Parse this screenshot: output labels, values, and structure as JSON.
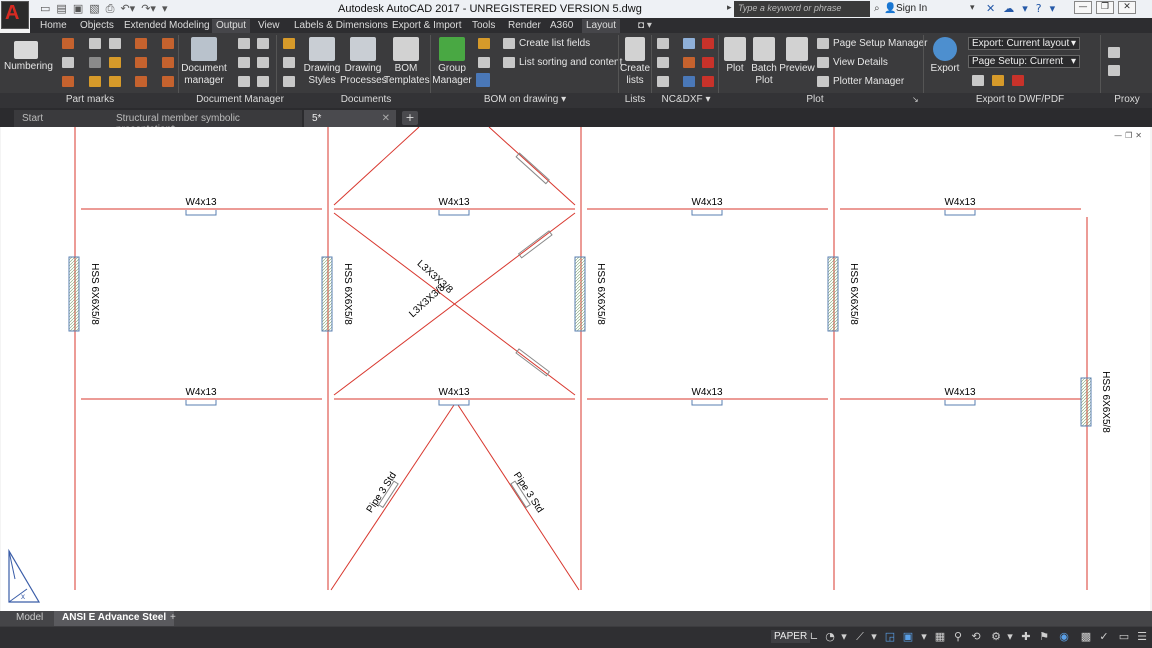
{
  "title_bar": {
    "title": "Autodesk AutoCAD 2017 - UNREGISTERED VERSION    5.dwg",
    "search_placeholder": "Type a keyword or phrase",
    "sign_in": "Sign In"
  },
  "menu_tabs": [
    "Home",
    "Objects",
    "Extended Modeling",
    "Output",
    "View",
    "Labels & Dimensions",
    "Export & Import",
    "Tools",
    "Render",
    "A360",
    "Layout"
  ],
  "ribbon": {
    "numbering": "Numbering",
    "document_manager": "Document\nmanager",
    "drawing_styles": "Drawing\nStyles",
    "drawing_processes": "Drawing\nProcesses",
    "bom_templates": "BOM\nTemplates",
    "group_manager": "Group\nManager",
    "create_list_fields": "Create list fields",
    "list_sorting": "List sorting and content",
    "create_lists": "Create\nlists",
    "plot": "Plot",
    "batch_plot": "Batch\nPlot",
    "preview": "Preview",
    "page_setup_manager": "Page Setup Manager",
    "view_details": "View Details",
    "plotter_manager": "Plotter Manager",
    "export": "Export",
    "export_dropdown": "Export: Current layout",
    "page_setup_dropdown": "Page Setup: Current",
    "panels": {
      "part_marks": "Part marks",
      "document_manager": "Document Manager",
      "documents": "Documents",
      "bom_on_drawing": "BOM on drawing",
      "lists": "Lists",
      "nc_dxf": "NC&DXF",
      "plot": "Plot",
      "export_dwf_pdf": "Export to DWF/PDF",
      "proxy": "Proxy"
    }
  },
  "doc_tabs": [
    "Start",
    "Structural member symbolic presentation*",
    "5*"
  ],
  "drawing": {
    "beam_label": "W4x13",
    "column_label": "HSS 6X6X5/8",
    "brace_angle_label": "L3X3X3/8",
    "pipe_label": "Pipe 3 Std",
    "line_color": "#d8372e",
    "label_color": "#000000"
  },
  "layout_tabs": [
    "Model",
    "ANSI E Advance Steel"
  ],
  "status": {
    "paper": "PAPER"
  }
}
